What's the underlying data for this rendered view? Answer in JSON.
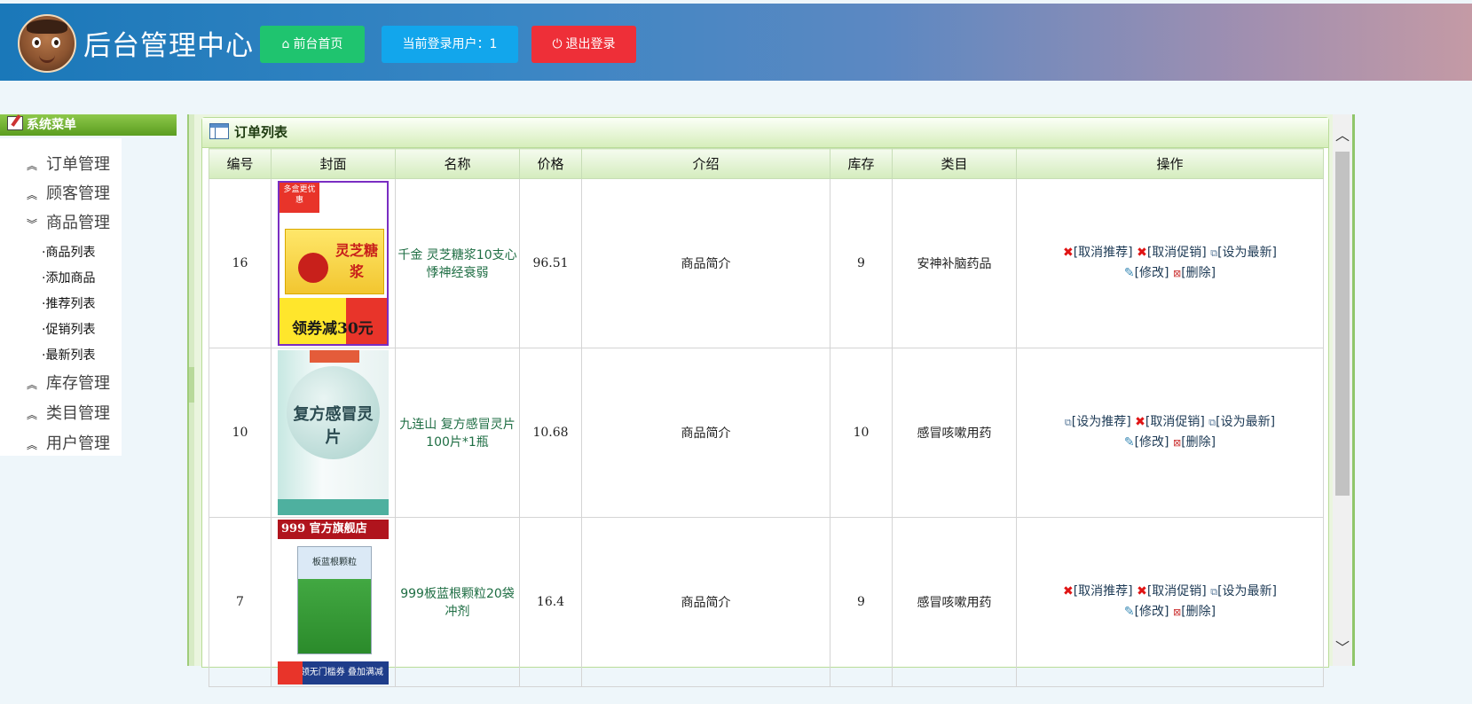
{
  "header": {
    "title": "后台管理中心",
    "home_label": "前台首页",
    "user_label": "当前登录用户：1",
    "logout_label": "退出登录"
  },
  "sidebar": {
    "heading": "系统菜单",
    "items": [
      {
        "label": "订单管理",
        "expanded": false
      },
      {
        "label": "顾客管理",
        "expanded": false
      },
      {
        "label": "商品管理",
        "expanded": true
      },
      {
        "label": "库存管理",
        "expanded": false
      },
      {
        "label": "类目管理",
        "expanded": false
      },
      {
        "label": "用户管理",
        "expanded": false
      }
    ],
    "sub_items": [
      "·商品列表",
      "·添加商品",
      "·推荐列表",
      "·促销列表",
      "·最新列表"
    ]
  },
  "panel": {
    "title": "订单列表",
    "columns": [
      "编号",
      "封面",
      "名称",
      "价格",
      "介绍",
      "库存",
      "类目",
      "操作"
    ]
  },
  "rows": [
    {
      "id": "16",
      "name": "千金 灵芝糖浆10支心悸神经衰弱",
      "price": "96.51",
      "intro": "商品简介",
      "stock": "9",
      "category": "安神补脑药品",
      "ops": {
        "recommend": "[取消推荐]",
        "promo": "[取消促销]",
        "newest": "[设为最新]",
        "edit": "[修改]",
        "delete": "[删除]"
      },
      "cover": {
        "badge": "多盒更优惠",
        "product": "灵芝糖浆",
        "banner": "领券减30元"
      }
    },
    {
      "id": "10",
      "name": "九连山 复方感冒灵片100片*1瓶",
      "price": "10.68",
      "intro": "商品简介",
      "stock": "10",
      "category": "感冒咳嗽用药",
      "ops": {
        "recommend": "[设为推荐]",
        "promo": "[取消促销]",
        "newest": "[设为最新]",
        "edit": "[修改]",
        "delete": "[删除]"
      },
      "cover": {
        "product": "复方感冒灵片"
      }
    },
    {
      "id": "7",
      "name": "999板蓝根颗粒20袋冲剂",
      "price": "16.4",
      "intro": "商品简介",
      "stock": "9",
      "category": "感冒咳嗽用药",
      "ops": {
        "recommend": "[取消推荐]",
        "promo": "[取消促销]",
        "newest": "[设为最新]",
        "edit": "[修改]",
        "delete": "[删除]"
      },
      "cover": {
        "badge": "999 官方旗舰店",
        "product": "板蓝根颗粒",
        "banner": "领无门槛券 叠加满减"
      }
    }
  ]
}
